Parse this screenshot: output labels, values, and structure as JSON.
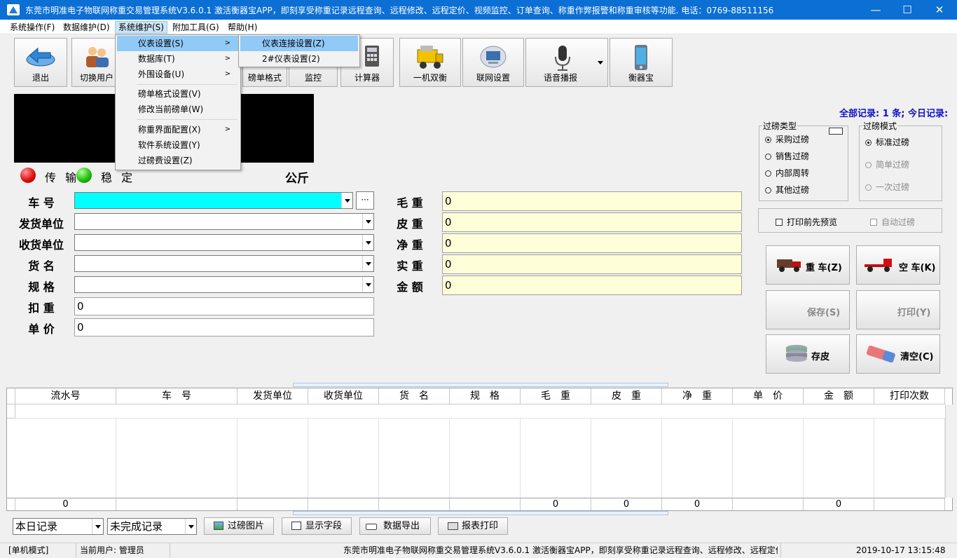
{
  "window": {
    "title": "东莞市明准电子物联网称重交易管理系统V3.6.0.1 激活衡器宝APP，即刻享受称重记录远程查询、远程修改、远程定价、视频监控、订单查询、称重作弊报警和称重审核等功能. 电话：0769-88511156",
    "minimize": "—",
    "maximize": "☐",
    "close": "✕"
  },
  "menubar": [
    "系统操作(F)",
    "数据维护(D)",
    "系统维护(S)",
    "附加工具(G)",
    "帮助(H)"
  ],
  "toolbar": {
    "exit": "退出",
    "switch_user": "切换用户",
    "slip_format": "磅单格式",
    "monitor": "监控",
    "calculator": "计算器",
    "dual_scale": "一机双衡",
    "network_settings": "联网设置",
    "voice_broadcast": "语音播报",
    "scale_treasure": "衡器宝"
  },
  "scale": {
    "signal_transfer": "传 输",
    "signal_stable": "稳 定",
    "unit": "公斤"
  },
  "records_summary": "全部记录: 1 条; 今日记录:",
  "form": {
    "left": [
      {
        "label": "车 号",
        "value": ""
      },
      {
        "label": "发货单位",
        "value": ""
      },
      {
        "label": "收货单位",
        "value": ""
      },
      {
        "label": "货 名",
        "value": ""
      },
      {
        "label": "规 格",
        "value": ""
      },
      {
        "label": "扣 重",
        "value": "0"
      },
      {
        "label": "单 价",
        "value": "0"
      }
    ],
    "right": [
      {
        "label": "毛 重",
        "value": "0"
      },
      {
        "label": "皮 重",
        "value": "0"
      },
      {
        "label": "净 重",
        "value": "0"
      },
      {
        "label": "实 重",
        "value": "0"
      },
      {
        "label": "金 额",
        "value": "0"
      }
    ],
    "browse_button": "···"
  },
  "weigh_type": {
    "title": "过磅类型",
    "options": [
      "采购过磅",
      "销售过磅",
      "内部周转",
      "其他过磅"
    ],
    "selected": 0
  },
  "weigh_mode": {
    "title": "过磅模式",
    "options": [
      "标准过磅",
      "简单过磅",
      "一次过磅"
    ],
    "selected": 0
  },
  "options": {
    "preview_before_print": "打印前先预览",
    "auto_weigh": "自动过磅"
  },
  "actions": {
    "heavy_truck": "重 车(Z)",
    "empty_truck": "空 车(K)",
    "save": "保存(S)",
    "print": "打印(Y)",
    "store_tare": "存皮",
    "clear": "清空(C)"
  },
  "table": {
    "columns": [
      "流水号",
      "车　号",
      "发货单位",
      "收货单位",
      "货　名",
      "规　格",
      "毛　重",
      "皮　重",
      "净　重",
      "单　价",
      "金　额",
      "打印次数"
    ],
    "totals": [
      "0",
      "",
      "",
      "",
      "",
      "",
      "0",
      "0",
      "0",
      "",
      "0",
      ""
    ]
  },
  "bottom": {
    "range_select": "本日记录",
    "status_select": "未完成记录",
    "weigh_picture": "过磅图片",
    "show_fields": "显示字段",
    "export_data": "数据导出",
    "report_print": "报表打印"
  },
  "statusbar": {
    "mode": "[单机模式]",
    "current_user": "当前用户: 管理员",
    "marquee": "东莞市明准电子物联网称重交易管理系统V3.6.0.1 激活衡器宝APP，即刻享受称重记录远程查询、远程修改、远程定价",
    "datetime": "2019-10-17 13:15:48"
  },
  "system_menu": {
    "items": [
      "仪表设置(S)",
      "数据库(T)",
      "外围设备(U)",
      "磅单格式设置(V)",
      "修改当前磅单(W)",
      "称重界面配置(X)",
      "软件系统设置(Y)",
      "过磅费设置(Z)"
    ]
  },
  "instrument_submenu": {
    "items": [
      "仪表连接设置(Z)",
      "2#仪表设置(2)"
    ]
  },
  "colors": {
    "titlebar": "#0b6fd4",
    "plate_input": "#00ffff",
    "weight_input": "#fefed8",
    "records_summary": "#1010c8",
    "display": "#000000"
  }
}
